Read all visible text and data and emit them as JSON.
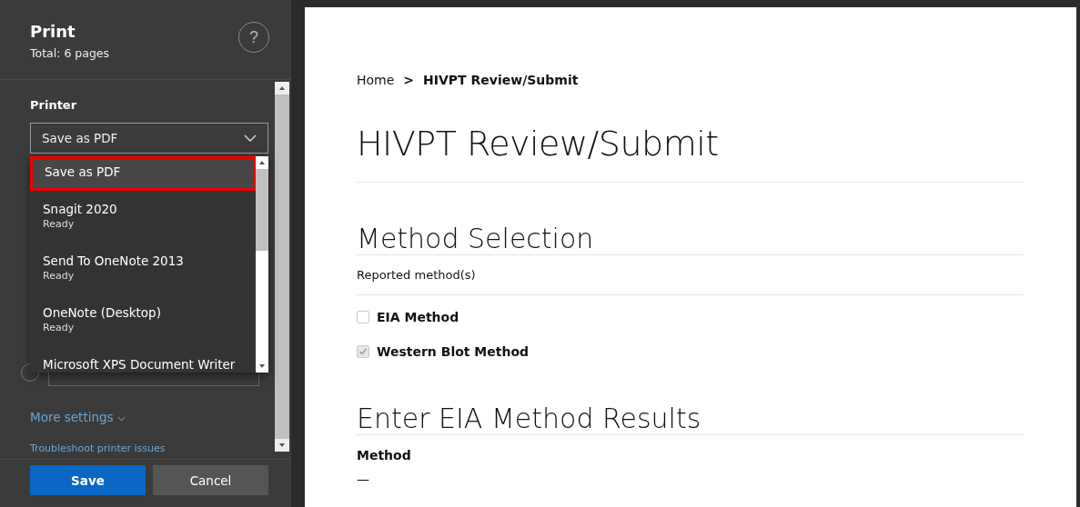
{
  "print_panel": {
    "title": "Print",
    "subtitle": "Total: 6 pages",
    "help_icon": "?",
    "printer_label": "Printer",
    "printer_select": {
      "value": "Save as PDF",
      "expanded": true
    },
    "printer_options": [
      {
        "name": "Save as PDF",
        "selected": true
      },
      {
        "name": "Snagit 2020",
        "status": "Ready",
        "selected": false
      },
      {
        "name": "Send To OneNote 2013",
        "status": "Ready",
        "selected": false
      },
      {
        "name": "OneNote (Desktop)",
        "status": "Ready",
        "selected": false
      },
      {
        "name": "Microsoft XPS Document Writer",
        "selected": false
      }
    ],
    "page_range_radio": {
      "selected": false
    },
    "more_settings": "More settings",
    "troubleshoot_link": "Troubleshoot printer issues",
    "buttons": [
      {
        "label": "Save",
        "kind": "primary"
      },
      {
        "label": "Cancel",
        "kind": "secondary"
      }
    ]
  },
  "page": {
    "breadcrumb": [
      {
        "label": "Home",
        "current": false
      },
      {
        "label": "HIVPT Review/Submit",
        "current": true
      }
    ],
    "breadcrumb_separator": ">",
    "title": "HIVPT Review/Submit",
    "section_title": "Method Selection",
    "field_label": "Reported method(s)",
    "methods": [
      {
        "label": "EIA Method",
        "checked": false
      },
      {
        "label": "Western Blot Method",
        "checked": true
      }
    ],
    "results_title": "Enter EIA Method Results",
    "method_label": "Method",
    "method_value": "—"
  }
}
